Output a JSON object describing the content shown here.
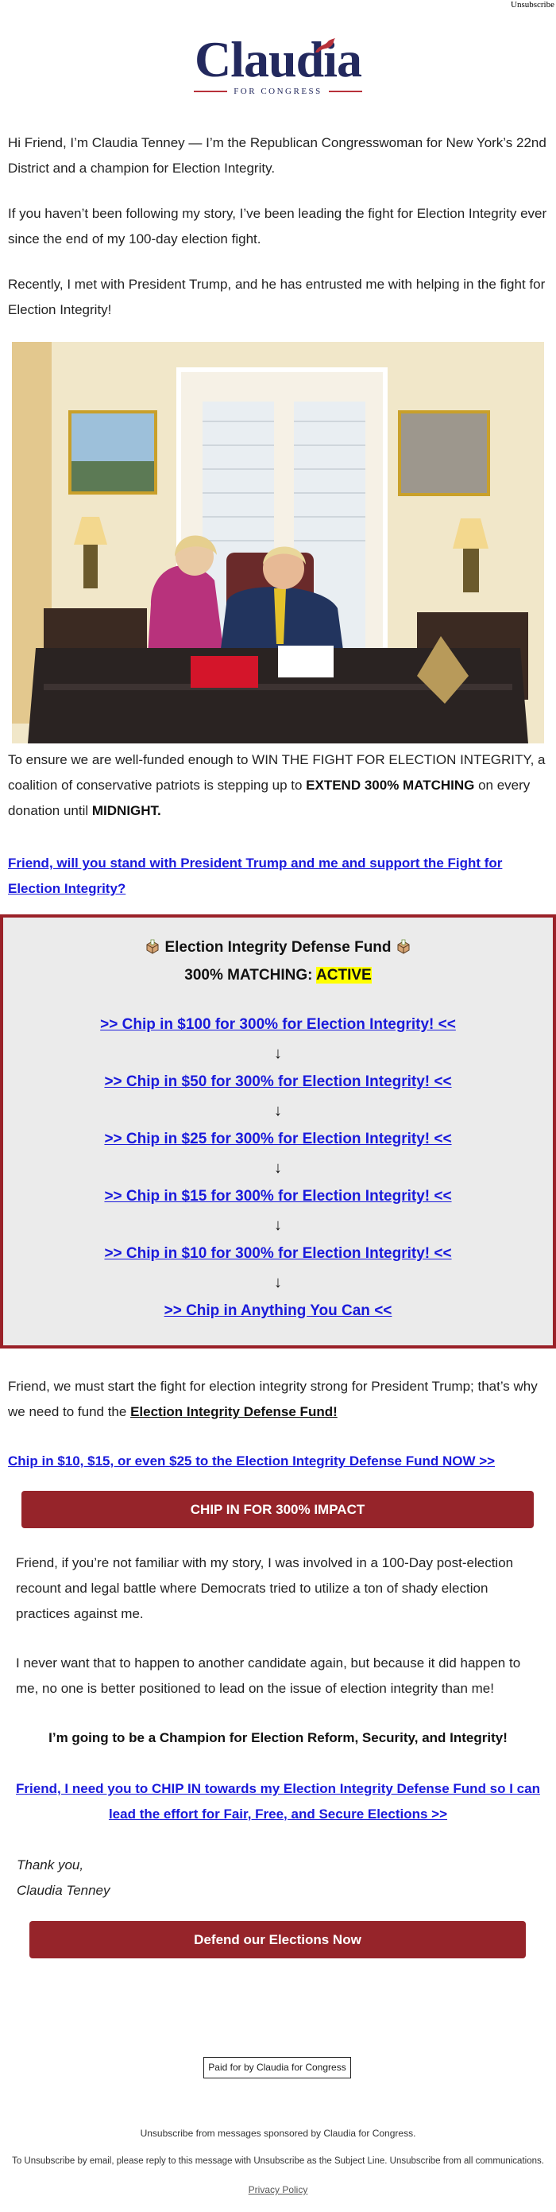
{
  "header": {
    "unsubscribe_label": "Unsubscribe",
    "logo": {
      "name": "Claudia",
      "tagline": "FOR CONGRESS",
      "navy": "#23295e",
      "red": "#b8313a"
    }
  },
  "intro": {
    "p1": "Hi Friend, I’m Claudia Tenney — I’m the Republican Congresswoman for New York’s 22nd District and a champion for Election Integrity.",
    "p2": "If you haven’t been following my story, I’ve been leading the fight for Election Integrity ever since the end of my 100-day election fight.",
    "p3": "Recently, I met with President Trump, and he has entrusted me with helping in the fight for Election Integrity!"
  },
  "photo": {
    "alt": "Claudia Tenney and President Trump seated at a desk in an office"
  },
  "funding": {
    "text_before": "To ensure we are well-funded enough to WIN THE FIGHT FOR ELECTION INTEGRITY, a coalition of conservative patriots is stepping up to ",
    "bold1": "EXTEND 300% MATCHING",
    "text_mid": " on every donation until ",
    "bold2": "MIDNIGHT.",
    "link": "Friend, will you stand with President Trump and me and support the Fight for Election Integrity?"
  },
  "fund_box": {
    "title": "Election Integrity Defense Fund",
    "matching_label": "300% MATCHING: ",
    "matching_status": "ACTIVE",
    "arrow": "↓",
    "links": [
      ">> Chip in $100 for 300% for Election Integrity! <<",
      ">> Chip in $50 for 300% for Election Integrity! <<",
      ">> Chip in $25 for 300% for Election Integrity! <<",
      ">> Chip in $15 for 300% for Election Integrity! <<",
      ">> Chip in $10 for 300% for Election Integrity! <<",
      ">> Chip in Anything You Can <<"
    ],
    "border_color": "#9a2128",
    "background": "#ebebeb",
    "highlight": "#ffff00"
  },
  "middle": {
    "p1_text": "Friend, we must start the fight for election integrity strong for President Trump; that’s why we need to fund the ",
    "p1_link": "Election Integrity Defense Fund!",
    "chip_link": "Chip in $10, $15, or even $25 to the Election Integrity Defense Fund NOW >> ",
    "cta1": "CHIP IN FOR 300% IMPACT",
    "story1": "Friend, if you’re not familiar with my story, I was involved in a 100-Day post-election recount and legal battle where Democrats tried to utilize a ton of shady election practices against me.",
    "story2": "I never want that to happen to another candidate again, but because it did happen to me, no one is better positioned to lead on the issue of election integrity than me!",
    "champion": "I’m going to be a Champion for Election Reform, Security, and Integrity!",
    "chip_in_link": "Friend, I need you to CHIP IN towards my Election Integrity Defense Fund so I can lead the effort for Fair, Free, and Secure Elections >>",
    "signoff": "Thank you,",
    "signature": "Claudia Tenney",
    "cta2": "Defend our Elections Now",
    "button_color": "#96242a"
  },
  "footer": {
    "paid_for": "Paid for by Claudia for Congress",
    "unsub_sponsored": "Unsubscribe from messages sponsored by Claudia for Congress.",
    "unsub_email": "To Unsubscribe by email, please reply to this message with Unsubscribe as the Subject Line. Unsubscribe from all communications.",
    "privacy": "Privacy Policy"
  }
}
